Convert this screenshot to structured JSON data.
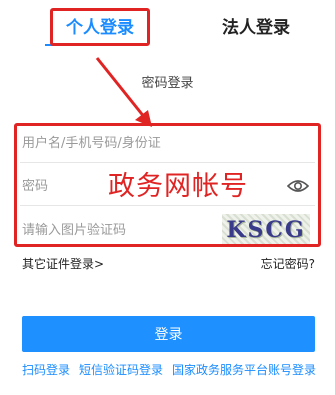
{
  "tabs": {
    "personal": "个人登录",
    "legal": "法人登录"
  },
  "mode_label": "密码登录",
  "form": {
    "username_placeholder": "用户名/手机号码/身份证",
    "password_placeholder": "密码",
    "captcha_placeholder": "请输入图片验证码",
    "captcha_text": "KSCG"
  },
  "annotation": {
    "label": "政务网帐号"
  },
  "links": {
    "other_cert": "其它证件登录>",
    "forgot": "忘记密码?"
  },
  "login_button": "登录",
  "bottom_links": {
    "scan": "扫码登录",
    "sms": "短信验证码登录",
    "national": "国家政务服务平台账号登录"
  },
  "colors": {
    "accent": "#1a8cff",
    "annotation": "#e02424",
    "button": "#1e90ff"
  }
}
